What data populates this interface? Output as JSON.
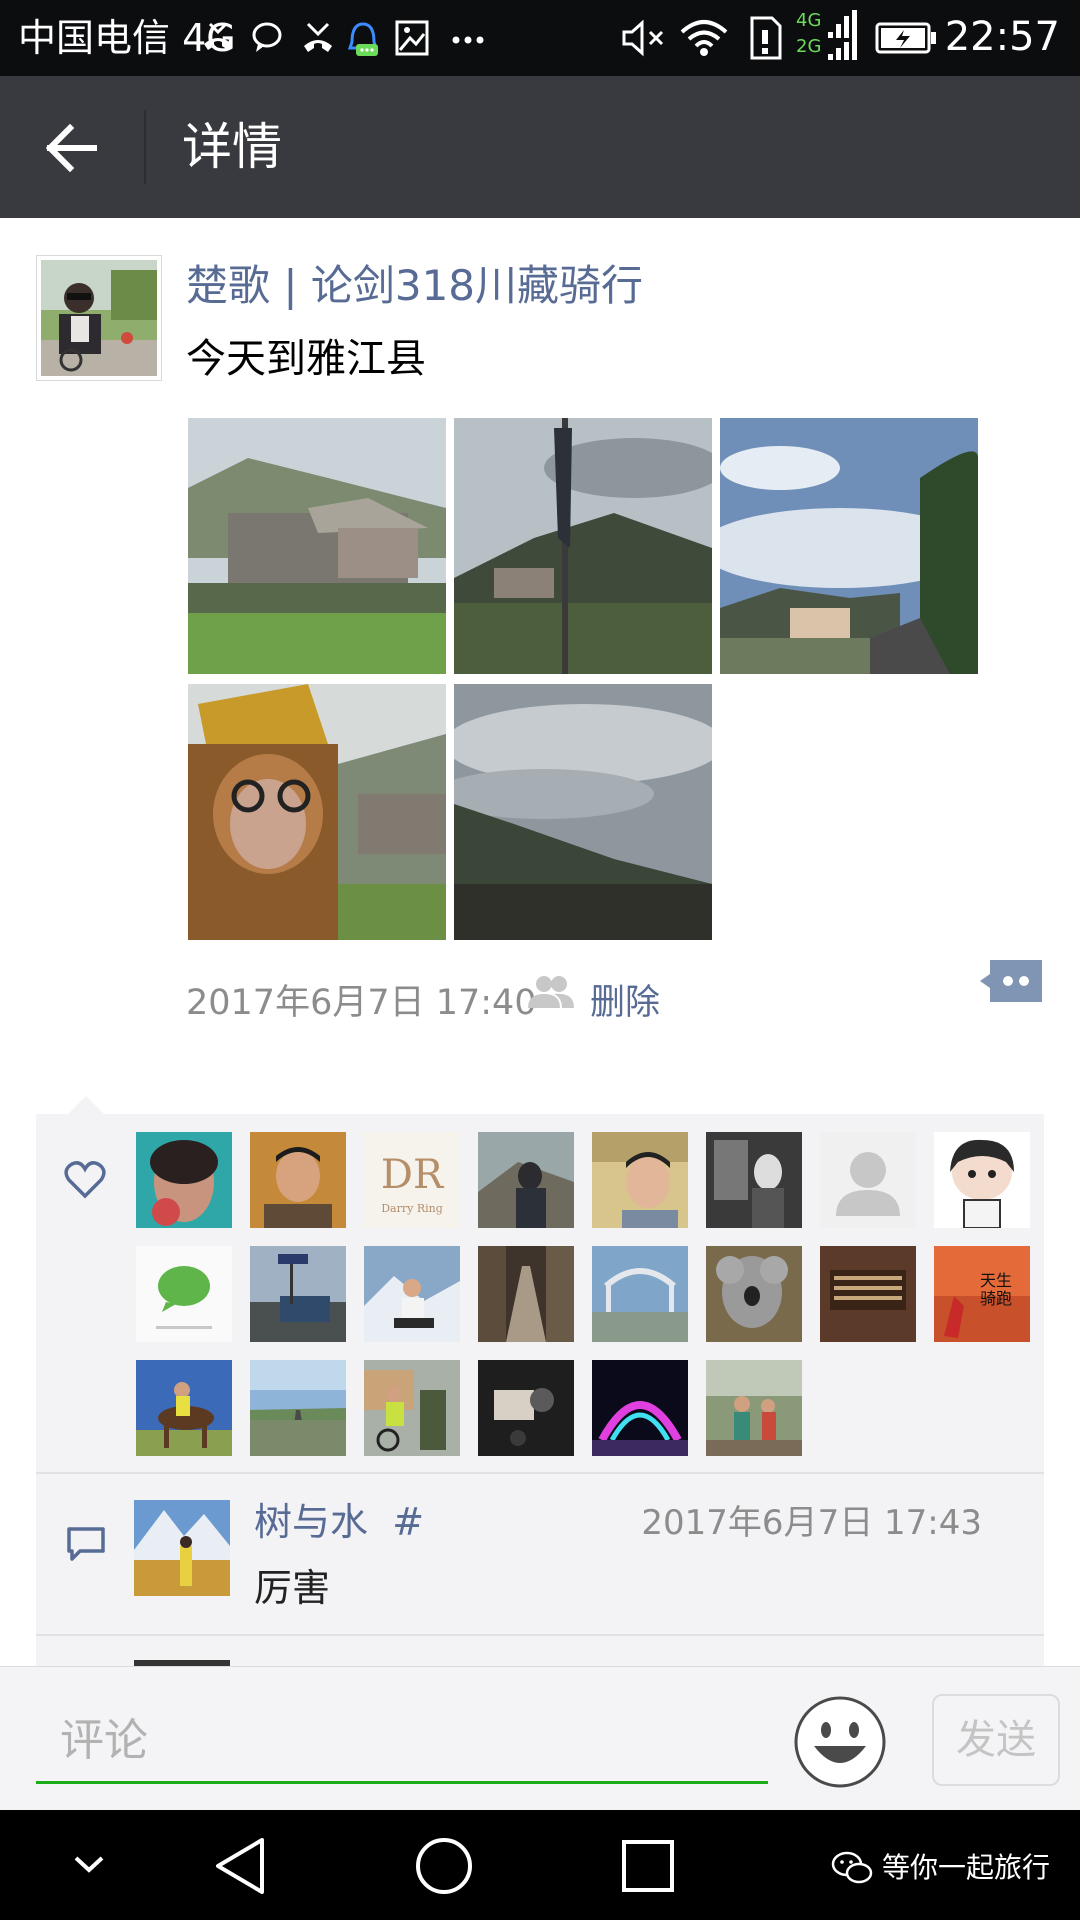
{
  "status_bar": {
    "carrier": "中国电信 4G",
    "time": "22:57",
    "network_badge_top": "4G",
    "network_badge_bottom": "2G",
    "icons": [
      "missed-call-icon",
      "chat-bubble-icon",
      "missed-call-icon",
      "qq-icon",
      "image-icon",
      "more-icon",
      "mute-icon",
      "wifi-icon",
      "sim-icon",
      "signal-icon",
      "battery-icon"
    ]
  },
  "title_bar": {
    "back_icon": "back-arrow-icon",
    "title": "详情"
  },
  "post": {
    "author": "楚歌 | 论剑318川藏骑行",
    "text": "今天到雅江县",
    "photo_count": 5,
    "timestamp": "2017年6月7日 17:40",
    "visibility_icon": "group-icon",
    "delete_label": "删除",
    "comment_toggle_icon": "comment-menu-icon"
  },
  "likes": {
    "icon": "heart-icon",
    "count": 22
  },
  "comments": [
    {
      "author": "树与水",
      "author_suffix": "#",
      "time": "2017年6月7日 17:43",
      "text": "厉害"
    }
  ],
  "comment_bar": {
    "placeholder": "评论",
    "emoji_icon": "emoji-icon",
    "send_label": "发送"
  },
  "nav_bar": {
    "icons": [
      "chevron-down-icon",
      "back-triangle-icon",
      "home-circle-icon",
      "recents-square-icon"
    ],
    "watermark": "等你一起旅行"
  },
  "colors": {
    "title_bar": "#393a3f",
    "link": "#576b95",
    "accent_green": "#1aad19",
    "interaction_bg": "#f3f3f5"
  }
}
